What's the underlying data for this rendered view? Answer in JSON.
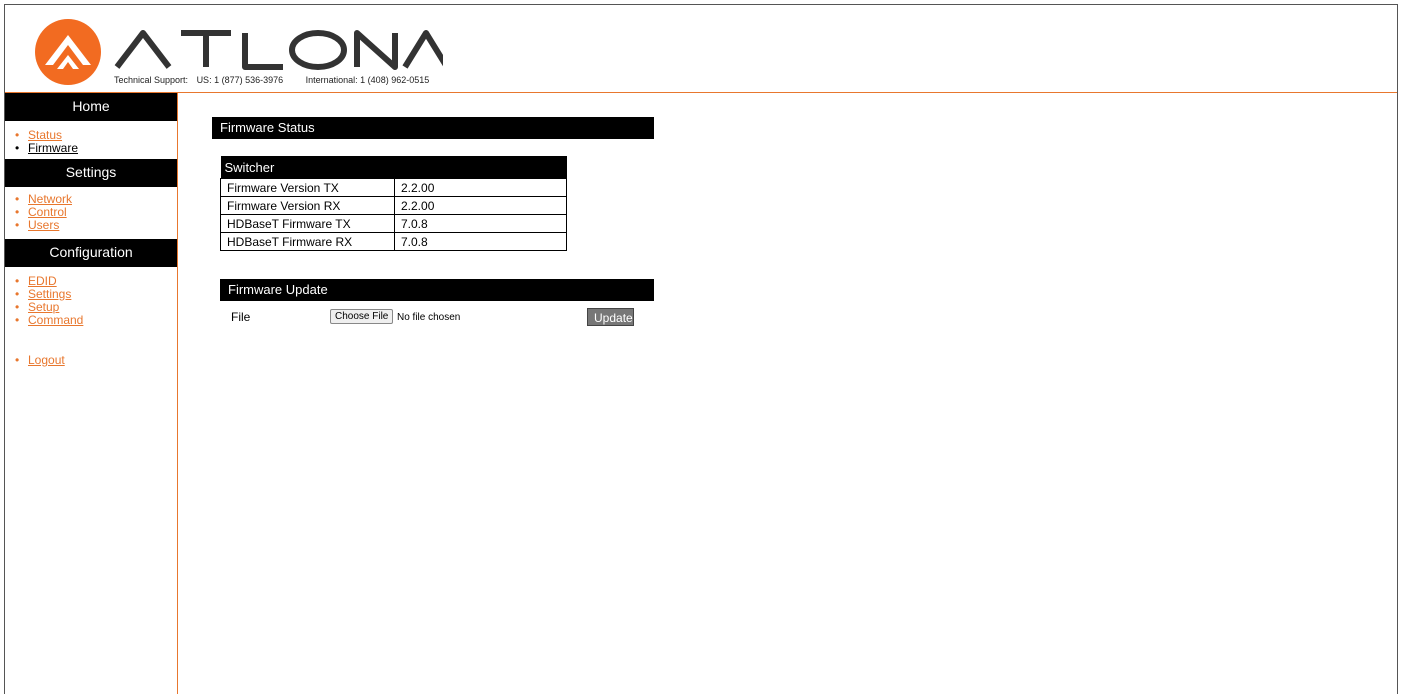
{
  "header": {
    "brand": "ATLONA",
    "support_label": "Technical Support:",
    "support_us": "US: 1 (877) 536-3976",
    "support_intl": "International: 1 (408) 962-0515",
    "accent_color": "#e8772e"
  },
  "sidebar": {
    "home": {
      "title": "Home",
      "items": [
        {
          "label": "Status"
        },
        {
          "label": "Firmware"
        }
      ]
    },
    "settings": {
      "title": "Settings",
      "items": [
        {
          "label": "Network"
        },
        {
          "label": "Control"
        },
        {
          "label": "Users"
        }
      ]
    },
    "configuration": {
      "title": "Configuration",
      "items": [
        {
          "label": "EDID"
        },
        {
          "label": "Settings"
        },
        {
          "label": "Setup"
        },
        {
          "label": "Command"
        }
      ]
    },
    "logout": "Logout"
  },
  "main": {
    "status_title": "Firmware Status",
    "table": {
      "header": "Switcher",
      "rows": [
        {
          "key": "Firmware Version TX",
          "value": "2.2.00"
        },
        {
          "key": "Firmware Version RX",
          "value": "2.2.00"
        },
        {
          "key": "HDBaseT Firmware TX",
          "value": "7.0.8"
        },
        {
          "key": "HDBaseT Firmware RX",
          "value": "7.0.8"
        }
      ]
    },
    "update_title": "Firmware Update",
    "file_label": "File",
    "choose_file": "Choose File",
    "no_file": "No file chosen",
    "update_button": "Update"
  }
}
